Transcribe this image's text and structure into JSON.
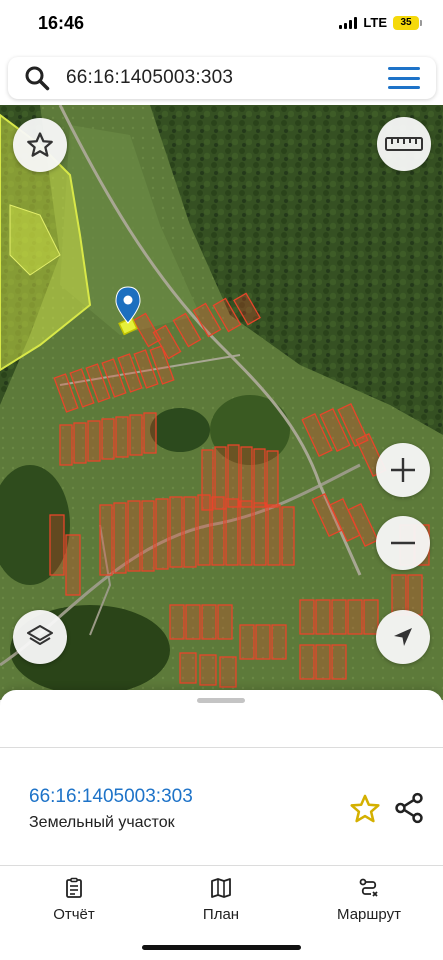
{
  "status_bar": {
    "time": "16:46",
    "network": "LTE",
    "battery": "35"
  },
  "search": {
    "value": "66:16:1405003:303"
  },
  "map": {
    "controls": [
      "favorite-icon",
      "ruler-icon",
      "zoom-in-icon",
      "zoom-out-icon",
      "layers-icon",
      "locate-icon"
    ],
    "colors": {
      "parcel_outline": "#e8452a",
      "selected_area": "#d8e848",
      "marker": "#1c6fbf"
    }
  },
  "sheet": {
    "parcel_id": "66:16:1405003:303",
    "parcel_type": "Земельный участок"
  },
  "tabs": [
    {
      "icon": "report-icon",
      "label": "Отчёт"
    },
    {
      "icon": "map-icon",
      "label": "План"
    },
    {
      "icon": "route-icon",
      "label": "Маршрут"
    }
  ]
}
